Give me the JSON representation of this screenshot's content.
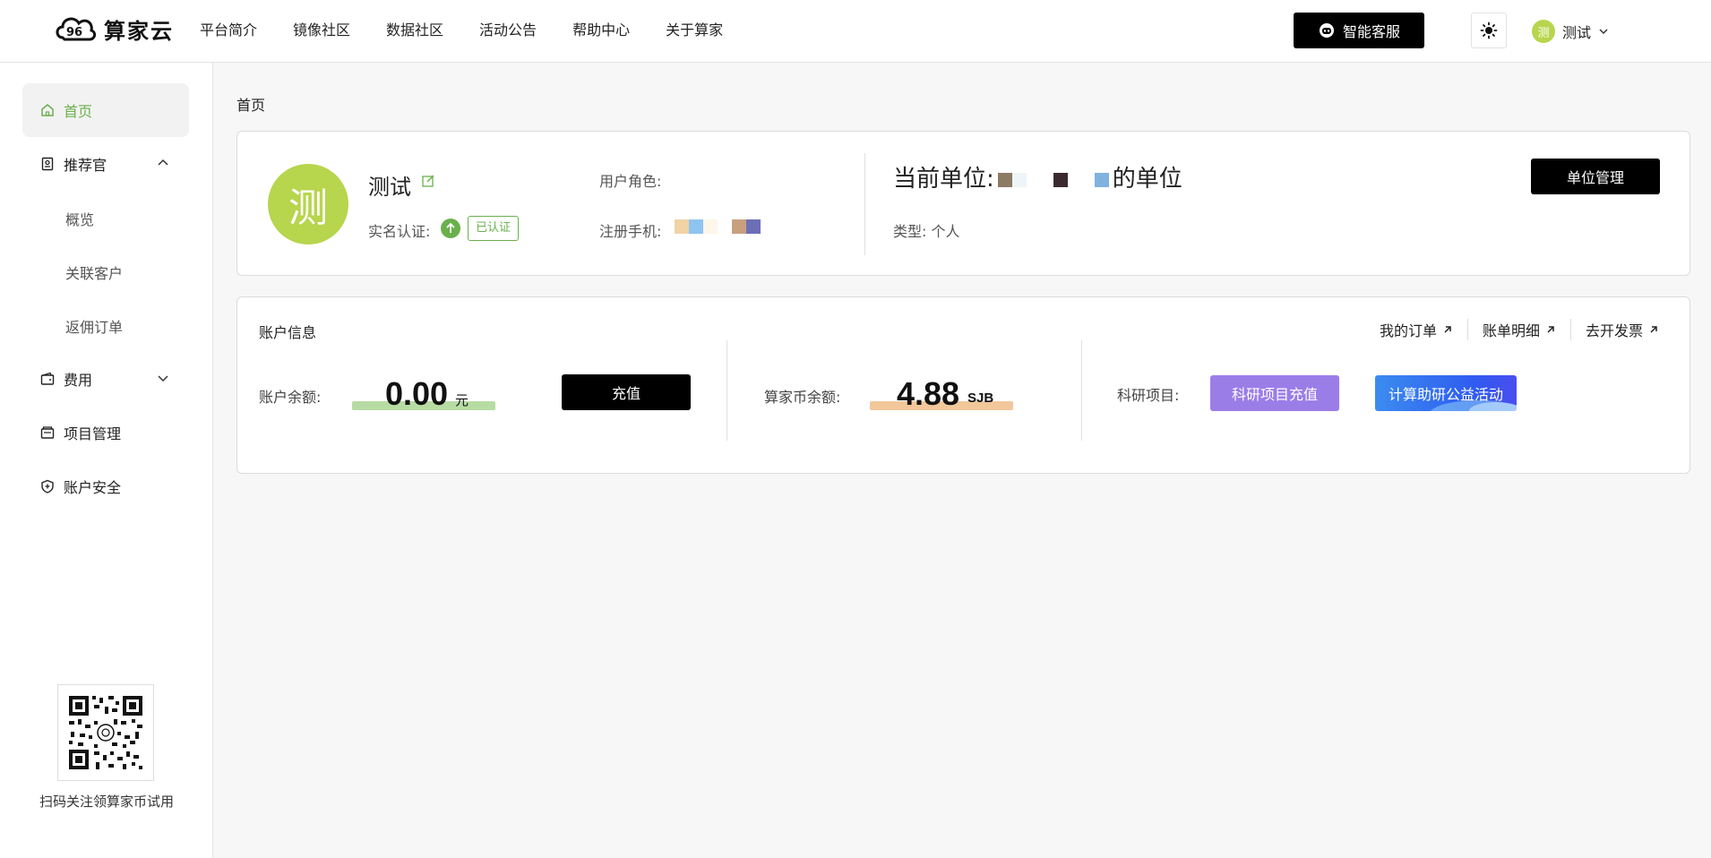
{
  "brand": {
    "name": "算家云"
  },
  "nav": {
    "items": [
      "平台简介",
      "镜像社区",
      "数据社区",
      "活动公告",
      "帮助中心",
      "关于算家"
    ]
  },
  "header": {
    "kefu_label": "智能客服",
    "user_initial": "测",
    "user_name": "测试"
  },
  "sidebar": {
    "items": [
      {
        "label": "首页",
        "icon": "home-icon"
      },
      {
        "label": "推荐官",
        "icon": "badge-icon"
      },
      {
        "label": "费用",
        "icon": "wallet-icon"
      },
      {
        "label": "项目管理",
        "icon": "folder-icon"
      },
      {
        "label": "账户安全",
        "icon": "shield-icon"
      }
    ],
    "sub_items": [
      "概览",
      "关联客户",
      "返佣订单"
    ],
    "qr_caption": "扫码关注领算家币试用"
  },
  "breadcrumb": "首页",
  "profile": {
    "avatar_initial": "测",
    "name": "测试",
    "realname_label": "实名认证:",
    "verified_tag": "已认证",
    "role_label": "用户角色:",
    "phone_label": "注册手机:",
    "unit_title_prefix": "当前单位:",
    "unit_title_suffix": "的单位",
    "unit_type": "类型:  个人",
    "unit_manage_label": "单位管理"
  },
  "account": {
    "title": "账户信息",
    "links": [
      "我的订单",
      "账单明细",
      "去开发票"
    ],
    "balance_label": "账户余额:",
    "balance_value": "0.00",
    "balance_unit": "元",
    "recharge_label": "充值",
    "coin_label": "算家币余额:",
    "coin_value": "4.88",
    "coin_unit": "SJB",
    "research_label": "科研项目:",
    "research_btn1": "科研项目充值",
    "research_btn2": "计算助研公益活动"
  },
  "colors": {
    "accent_green": "#6ab04c",
    "avatar_green": "#b7d54d",
    "purple_btn": "#9b7de8",
    "blue_btn": "#2f5cf0"
  }
}
